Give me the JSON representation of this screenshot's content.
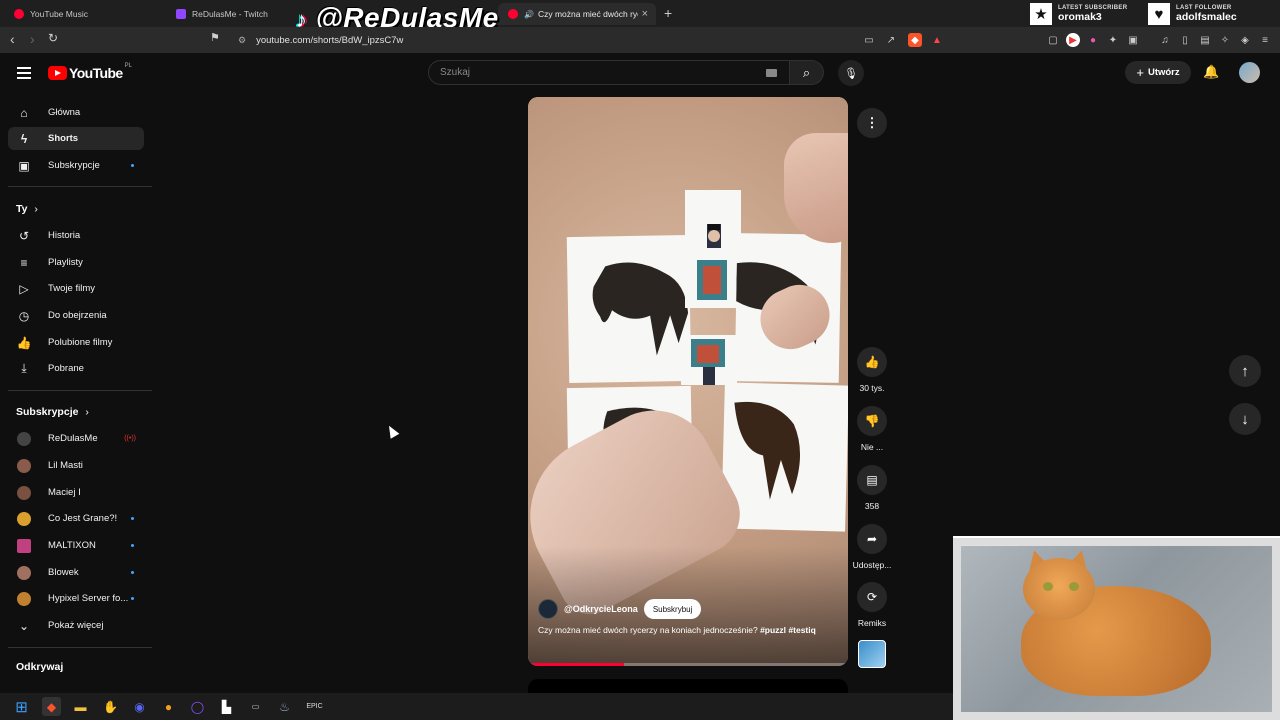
{
  "browser": {
    "tabs": [
      {
        "label": "YouTube Music",
        "color": "#ff0033"
      },
      {
        "label": "ReDulasMe - Twitch",
        "color": "#9146ff"
      },
      {
        "label": "Czy można mieć dwóch rycerzy",
        "color": "#ff0033"
      }
    ],
    "url": "youtube.com/shorts/BdW_ipzsC7w"
  },
  "stream_overlay": {
    "watermark": "@ReDulasMe",
    "latest_subscriber_label": "LATEST SUBSCRIBER",
    "latest_subscriber": "oromak3",
    "last_follower_label": "LAST FOLLOWER",
    "last_follower": "adolfsmalec"
  },
  "header": {
    "logo_text": "YouTube",
    "region": "PL",
    "search_placeholder": "Szukaj",
    "create_label": "Utwórz"
  },
  "sidebar": {
    "main": [
      {
        "label": "Główna",
        "icon": "home-icon",
        "glyph": "⌂"
      },
      {
        "label": "Shorts",
        "icon": "shorts-icon",
        "glyph": "ϟ"
      },
      {
        "label": "Subskrypcje",
        "icon": "subscriptions-icon",
        "glyph": "▣"
      }
    ],
    "you_heading": "Ty",
    "you": [
      {
        "label": "Historia",
        "icon": "history-icon",
        "glyph": "↺"
      },
      {
        "label": "Playlisty",
        "icon": "playlists-icon",
        "glyph": "≡"
      },
      {
        "label": "Twoje filmy",
        "icon": "your-videos-icon",
        "glyph": "▷"
      },
      {
        "label": "Do obejrzenia",
        "icon": "watch-later-icon",
        "glyph": "◷"
      },
      {
        "label": "Polubione filmy",
        "icon": "liked-icon",
        "glyph": "👍"
      },
      {
        "label": "Pobrane",
        "icon": "download-icon",
        "glyph": "⤓"
      }
    ],
    "subs_heading": "Subskrypcje",
    "subscriptions": [
      {
        "label": "ReDulasMe",
        "color": "#444"
      },
      {
        "label": "Lil Masti",
        "color": "#8a5a4a"
      },
      {
        "label": "Maciej I",
        "color": "#7a5040"
      },
      {
        "label": "Co Jest Grane?!",
        "color": "#d9a030"
      },
      {
        "label": "MALTIXON",
        "color": "#c04080"
      },
      {
        "label": "Blowek",
        "color": "#a07060"
      },
      {
        "label": "Hypixel Server fo...",
        "color": "#c08030"
      }
    ],
    "show_more": "Pokaż więcej",
    "explore_heading": "Odkrywaj"
  },
  "short": {
    "channel": "@OdkrycieLeona",
    "subscribe_label": "Subskrybuj",
    "caption_text": "Czy można mieć dwóch rycerzy na koniach jednocześnie?",
    "hashtag1": "#puzzl",
    "hashtag2": "#testiq",
    "progress": 0.3,
    "likes": "30 tys.",
    "dislike_label": "Nie ...",
    "comments": "358",
    "share_label": "Udostęp...",
    "remix_label": "Remiks"
  }
}
